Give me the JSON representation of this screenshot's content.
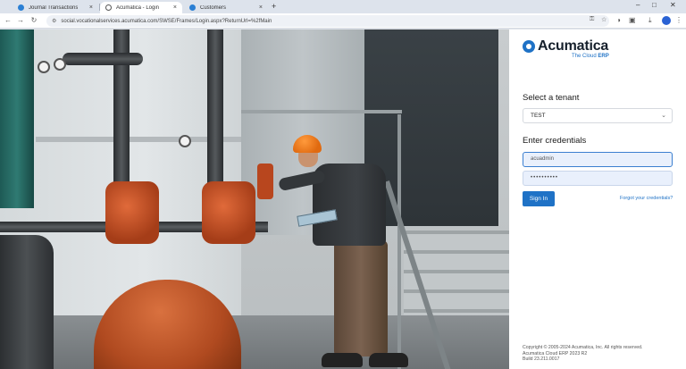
{
  "browser": {
    "tabs": [
      {
        "label": "Journal Transactions",
        "favicon": "acumatica-favicon",
        "active": false
      },
      {
        "label": "Acumatica - Login",
        "favicon": "globe-favicon",
        "active": true
      },
      {
        "label": "Customers",
        "favicon": "acumatica-favicon",
        "active": false
      }
    ],
    "close_glyph": "×",
    "new_tab_glyph": "+",
    "address": "social.vocationalservices.acumatica.com/SWSE/Frames/Login.aspx?ReturnUrl=%2fMain"
  },
  "login": {
    "logo_text": "Acumatica",
    "logo_sub_prefix": "The Cloud ",
    "logo_sub_bold": "ERP",
    "tenant_heading": "Select a tenant",
    "tenant_value": "TEST",
    "credentials_heading": "Enter credentials",
    "username_value": "acuadmin",
    "password_value": "••••••••••",
    "signin_label": "Sign In",
    "forgot_label": "Forgot your credentials?",
    "footer_line1": "Copyright © 2005-2024 Acumatica, Inc. All rights reserved.",
    "footer_line2": "Acumatica Cloud ERP 2023 R2",
    "footer_line3": "Build 23.211.0017",
    "accent_color": "#1f72c6"
  }
}
